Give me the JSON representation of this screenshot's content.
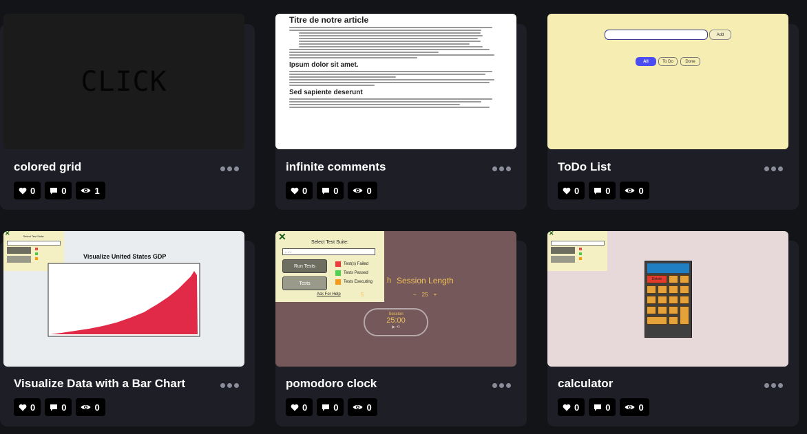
{
  "colors": {
    "page_bg": "#131417",
    "card_bg": "#1e1f26",
    "stat_bg": "#000000",
    "more_dots": "#8a8c99"
  },
  "icons": {
    "likes": "heart-icon",
    "comments": "comment-icon",
    "views": "eye-icon",
    "more": "more-dots-icon"
  },
  "cards": [
    {
      "title": "colored grid",
      "likes": "0",
      "comments": "0",
      "views": "1",
      "preview": {
        "text": "CLICK"
      }
    },
    {
      "title": "infinite comments",
      "likes": "0",
      "comments": "0",
      "views": "0",
      "preview": {
        "heading": "Titre de notre article",
        "sub1": "Ipsum dolor sit amet.",
        "sub2": "Sed sapiente deserunt"
      }
    },
    {
      "title": "ToDo List",
      "likes": "0",
      "comments": "0",
      "views": "0",
      "preview": {
        "add_label": "Add",
        "filters": [
          "All",
          "To Do",
          "Done"
        ]
      }
    },
    {
      "title": "Visualize Data with a Bar Chart",
      "likes": "0",
      "comments": "0",
      "views": "0",
      "preview": {
        "chart_title": "Visualize United States GDP",
        "panel_label": "Select Test Suite:"
      }
    },
    {
      "title": "pomodoro clock",
      "likes": "0",
      "comments": "0",
      "views": "0",
      "preview": {
        "panel_label": "Select Test Suite:",
        "select_value": "- - -",
        "run_tests": "Run Tests",
        "tests": "Tests",
        "legend": [
          "Test(s) Failed",
          "Tests Passed",
          "Tests Executing"
        ],
        "help": "Ask For Help",
        "session_length_label": "Session Length",
        "session_length_value": "25",
        "timer_label": "Session",
        "timer_value": "25:00"
      }
    },
    {
      "title": "calculator",
      "likes": "0",
      "comments": "0",
      "views": "0",
      "preview": {
        "delete_label": "Delete"
      }
    }
  ]
}
